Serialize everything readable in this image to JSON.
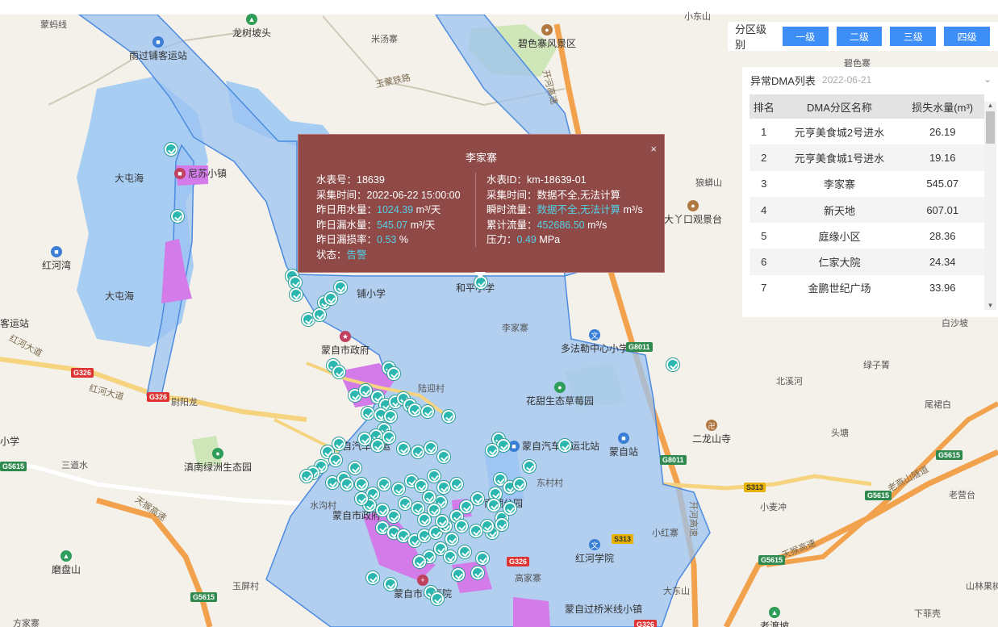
{
  "map": {
    "labels": {
      "l1": "蒙蚂线",
      "l2": "龙树坡头",
      "l3": "米汤寨",
      "l4": "碧色寨风景区",
      "l5": "雨过铺客运站",
      "l6": "玉蒙铁路",
      "l7": "开河高速",
      "l8": "大屯海",
      "l9": "尼苏小镇",
      "l10": "红河湾",
      "l11": "大屯海",
      "l12": "红河大道",
      "l13": "红河大道",
      "l14": "蒙自市政府",
      "l15": "铺小学",
      "l16": "和平小学",
      "l17": "李家寨",
      "l18": "多法勒中心小学",
      "l19": "狼蟒山",
      "l20": "大丫口观景台",
      "l21": "陆迎村",
      "l22": "花甜生态草莓园",
      "l23": "蒙自汽车客运北站",
      "l24": "蒙自站",
      "l25": "二龙山寺",
      "l26": "三道水",
      "l27": "滇南绿洲生态园",
      "l28": "天猴高速",
      "l29": "水沟村",
      "l30": "南湖公园",
      "l31": "东村村",
      "l32": "小麦冲",
      "l33": "小红寨",
      "l34": "红河学院",
      "l35": "磨盘山",
      "l36": "玉屏村",
      "l37": "蒙自市中医院",
      "l38": "高家寨",
      "l39": "蒙自过桥米线小镇",
      "l40": "方家寨",
      "l41": "老渡坡",
      "l42": "下菲壳",
      "l43": "山林果树",
      "l44": "老营台",
      "l45": "天猴高速",
      "l46": "老燕山隧道",
      "l47": "北溪河",
      "l48": "头塘",
      "l49": "尾裙白",
      "l50": "绿子箐",
      "l51": "白沙坡",
      "l52": "蒙自汽车客运",
      "l53": "碧色寨",
      "l54": "客运站",
      "l55": "小学",
      "l56": "尉阳龙",
      "l57": "蒙自市政府",
      "l58": "开河高速",
      "l59": "大东山",
      "l60": "小东山"
    },
    "shields": {
      "s1": "G326",
      "s2": "G326",
      "s3": "G8011",
      "s4": "G8011",
      "s5": "G5615",
      "s6": "G5615",
      "s7": "G5615",
      "s8": "G5615",
      "s9": "G5615",
      "s10": "S313",
      "s11": "S313",
      "s12": "G326",
      "s13": "G326"
    }
  },
  "level_panel": {
    "title": "分区级别",
    "buttons": [
      "一级",
      "二级",
      "三级",
      "四级"
    ]
  },
  "dma_list": {
    "title": "异常DMA列表",
    "date": "2022-06-21",
    "columns": [
      "排名",
      "DMA分区名称",
      "损失水量(m³)"
    ],
    "rows": [
      {
        "rank": "1",
        "name": "元亨美食城2号进水",
        "loss": "26.19"
      },
      {
        "rank": "2",
        "name": "元亨美食城1号进水",
        "loss": "19.16"
      },
      {
        "rank": "3",
        "name": "李家寨",
        "loss": "545.07"
      },
      {
        "rank": "4",
        "name": "新天地",
        "loss": "607.01"
      },
      {
        "rank": "5",
        "name": "庭缘小区",
        "loss": "28.36"
      },
      {
        "rank": "6",
        "name": "仁家大院",
        "loss": "24.34"
      },
      {
        "rank": "7",
        "name": "金鹏世纪广场",
        "loss": "33.96"
      }
    ]
  },
  "popup": {
    "title": "李家寨",
    "close": "×",
    "meter_no_label": "水表号：",
    "meter_no": "18639",
    "collect_time_label": "采集时间：",
    "collect_time": "2022-06-22 15:00:00",
    "yesterday_use_label": "昨日用水量：",
    "yesterday_use": "1024.39",
    "yesterday_use_unit": " m³/天",
    "yesterday_leak_label": "昨日漏水量：",
    "yesterday_leak": "545.07",
    "yesterday_leak_unit": " m³/天",
    "leak_rate_label": "昨日漏损率：",
    "leak_rate": "0.53",
    "leak_rate_unit": " %",
    "status_label": "状态：",
    "status": "告警",
    "meter_id_label": "水表ID：",
    "meter_id": "km-18639-01",
    "collect_time2_label": "采集时间：",
    "collect_time2": "数据不全,无法计算",
    "instant_flow_label": "瞬时流量：",
    "instant_flow": "数据不全,无法计算",
    "instant_flow_unit": " m³/s",
    "cum_flow_label": "累计流量：",
    "cum_flow": "452686.50",
    "cum_flow_unit": " m³/s",
    "pressure_label": "压力：",
    "pressure": "0.49",
    "pressure_unit": " MPa"
  }
}
